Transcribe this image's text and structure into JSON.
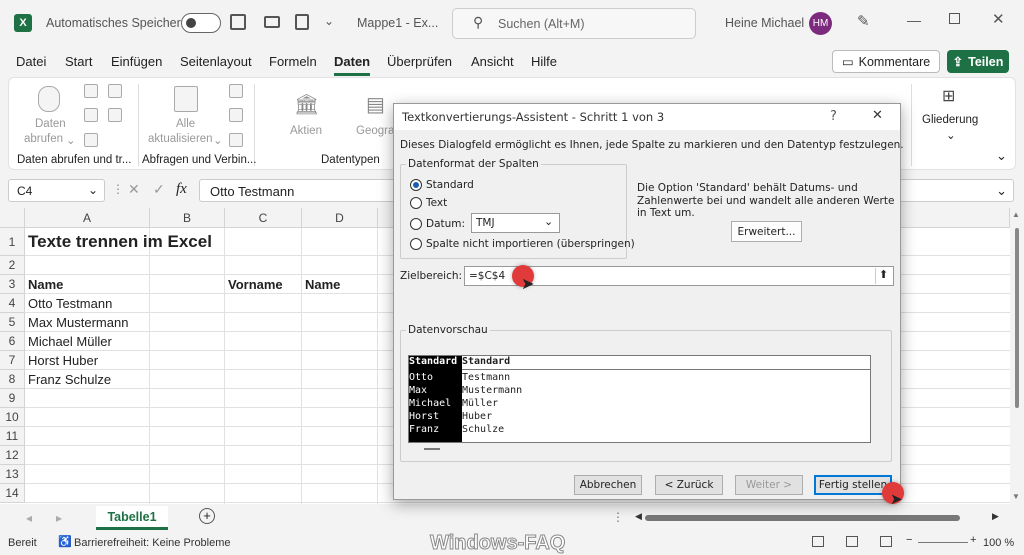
{
  "titlebar": {
    "autosave_label": "Automatisches Speichern",
    "filename": "Mappe1 - Ex...",
    "search_placeholder": "Suchen (Alt+M)",
    "user_name": "Heine Michael",
    "user_initials": "HM"
  },
  "menu": {
    "items": [
      "Datei",
      "Start",
      "Einfügen",
      "Seitenlayout",
      "Formeln",
      "Daten",
      "Überprüfen",
      "Ansicht",
      "Hilfe"
    ],
    "active": "Daten",
    "comments_label": "Kommentare",
    "share_label": "Teilen"
  },
  "ribbon": {
    "get_data_label_1": "Daten",
    "get_data_label_2": "abrufen",
    "refresh_label_1": "Alle",
    "refresh_label_2": "aktualisieren",
    "stocks_label": "Aktien",
    "geo_label": "Geogra",
    "outline_label": "Gliederung",
    "group_get_data": "Daten abrufen und tr...",
    "group_queries": "Abfragen und Verbin...",
    "group_datatypes": "Datentypen"
  },
  "formula": {
    "name_box": "C4",
    "fx": "fx",
    "value": "Otto Testmann"
  },
  "grid": {
    "columns": [
      "A",
      "B",
      "C",
      "D"
    ],
    "rows": [
      "1",
      "2",
      "3",
      "4",
      "5",
      "6",
      "7",
      "8",
      "9",
      "10",
      "11",
      "12",
      "13",
      "14"
    ],
    "a1": "Texte trennen im Excel",
    "a3": "Name",
    "c3": "Vorname",
    "d3": "Name",
    "names": [
      "Otto Testmann",
      "Max Mustermann",
      "Michael Müller",
      "Horst Huber",
      "Franz Schulze"
    ]
  },
  "sheet": {
    "tab": "Tabelle1"
  },
  "status": {
    "ready": "Bereit",
    "accessibility": "Barrierefreiheit: Keine Probleme",
    "watermark": "Windows-FAQ",
    "zoom": "100 %"
  },
  "dialog": {
    "title": "Textkonvertierungs-Assistent - Schritt 1 von 3",
    "help": "?",
    "close": "✕",
    "intro": "Dieses Dialogfeld ermöglicht es Ihnen, jede Spalte zu markieren und den Datentyp festzulegen.",
    "format_legend": "Datenformat der Spalten",
    "options": [
      "Standard",
      "Text",
      "Datum:",
      "Spalte nicht importieren (überspringen)"
    ],
    "selected_option": "Standard",
    "date_format": "TMJ",
    "note": "Die Option 'Standard' behält Datums- und Zahlenwerte bei und wandelt alle anderen Werte in Text um.",
    "advanced_button": "Erweitert...",
    "target_label": "Zielbereich:",
    "target_value": "=$C$4",
    "preview_legend": "Datenvorschau",
    "preview_headers": [
      "Standard",
      "Standard"
    ],
    "preview_rows": [
      [
        "Otto",
        "Testmann"
      ],
      [
        "Max",
        "Mustermann"
      ],
      [
        "Michael",
        "Müller"
      ],
      [
        "Horst",
        "Huber"
      ],
      [
        "Franz",
        "Schulze"
      ]
    ],
    "buttons": {
      "cancel": "Abbrechen",
      "back": "< Zurück",
      "next": "Weiter >",
      "finish": "Fertig stellen"
    }
  }
}
